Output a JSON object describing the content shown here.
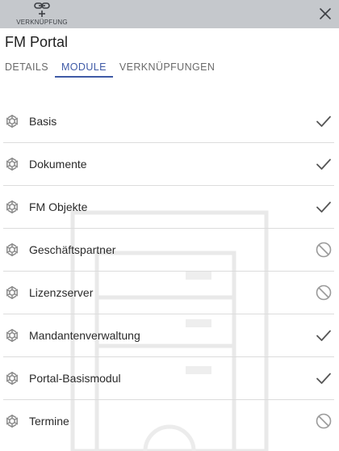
{
  "toolbar": {
    "link_label": "VERKNÜPFUNG",
    "link_icon": "link-plus-icon",
    "close_icon": "close-icon"
  },
  "page": {
    "title": "FM Portal"
  },
  "tabs": [
    {
      "label": "DETAILS",
      "active": false
    },
    {
      "label": "MODULE",
      "active": true
    },
    {
      "label": "VERKNÜPFUNGEN",
      "active": false
    }
  ],
  "modules": [
    {
      "label": "Basis",
      "status": "enabled",
      "status_icon": "check-icon"
    },
    {
      "label": "Dokumente",
      "status": "enabled",
      "status_icon": "check-icon"
    },
    {
      "label": "FM Objekte",
      "status": "enabled",
      "status_icon": "check-icon"
    },
    {
      "label": "Geschäftspartner",
      "status": "disabled",
      "status_icon": "block-icon"
    },
    {
      "label": "Lizenzserver",
      "status": "disabled",
      "status_icon": "block-icon"
    },
    {
      "label": "Mandantenverwaltung",
      "status": "enabled",
      "status_icon": "check-icon"
    },
    {
      "label": "Portal-Basismodul",
      "status": "enabled",
      "status_icon": "check-icon"
    },
    {
      "label": "Termine",
      "status": "disabled",
      "status_icon": "block-icon"
    }
  ],
  "colors": {
    "header_bg": "#c5c8cc",
    "accent": "#3f5aa6",
    "icon_gray": "#8a8a8a"
  }
}
